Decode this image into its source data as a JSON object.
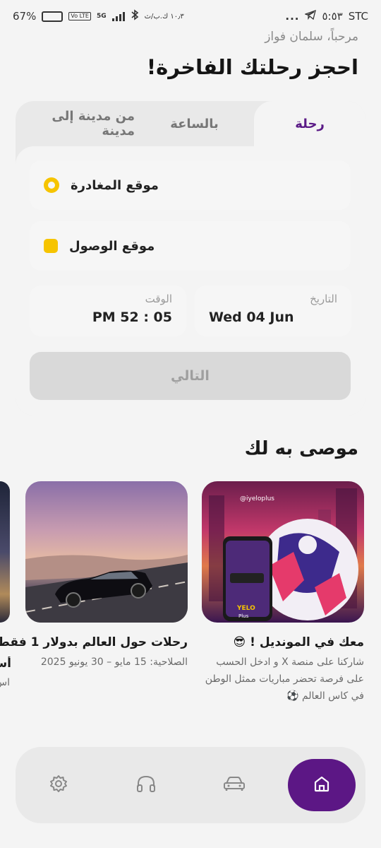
{
  "status_bar": {
    "carrier": "STC",
    "time": "٥:٥٣",
    "battery_percent": "67%",
    "battery_level": 0.67,
    "network": "5G",
    "volte": "Vo LTE",
    "data_speed": "١٠٫٣ ك.ب/ث",
    "more": "..."
  },
  "header": {
    "greeting": "مرحباً، سلمان فواز",
    "title": "احجز رحلتك الفاخرة!"
  },
  "booking": {
    "tabs": [
      {
        "label": "رحلة",
        "active": true
      },
      {
        "label": "بالساعة",
        "active": false
      },
      {
        "label": "من مدينة إلى مدينة",
        "active": false
      }
    ],
    "pickup_label": "موقع المغادرة",
    "dropoff_label": "موقع الوصول",
    "date_label": "التاريخ",
    "date_value": "Wed 04 Jun",
    "time_label": "الوقت",
    "time_value": "PM 52 : 05",
    "next_label": "التالي"
  },
  "recommendations": {
    "title": "موصى به لك",
    "cards": [
      {
        "title": "معك في المونديل ! 😎",
        "subtitle": "شاركنا على منصة X و ادخل الحسب على فرصة تحضر مباريات ممثل الوطن في كاس العالم ⚽",
        "watermark": "@iyeloplus",
        "phone_brand": "YELO",
        "phone_brand_sub": "Plus"
      },
      {
        "title": "رحلات حول العالم  بدولار 1 فقط",
        "subtitle": "الصلاحية: 15 مايو – 30 يونيو 2025"
      },
      {
        "title": "أس",
        "subtitle": "اس"
      }
    ]
  },
  "nav": {
    "items": [
      {
        "icon": "home-icon",
        "active": true
      },
      {
        "icon": "car-icon",
        "active": false
      },
      {
        "icon": "headphones-icon",
        "active": false
      },
      {
        "icon": "gear-icon",
        "active": false
      }
    ]
  },
  "colors": {
    "accent": "#5c1785",
    "yellow": "#f6c400",
    "tab_active": "#5a1a86"
  }
}
